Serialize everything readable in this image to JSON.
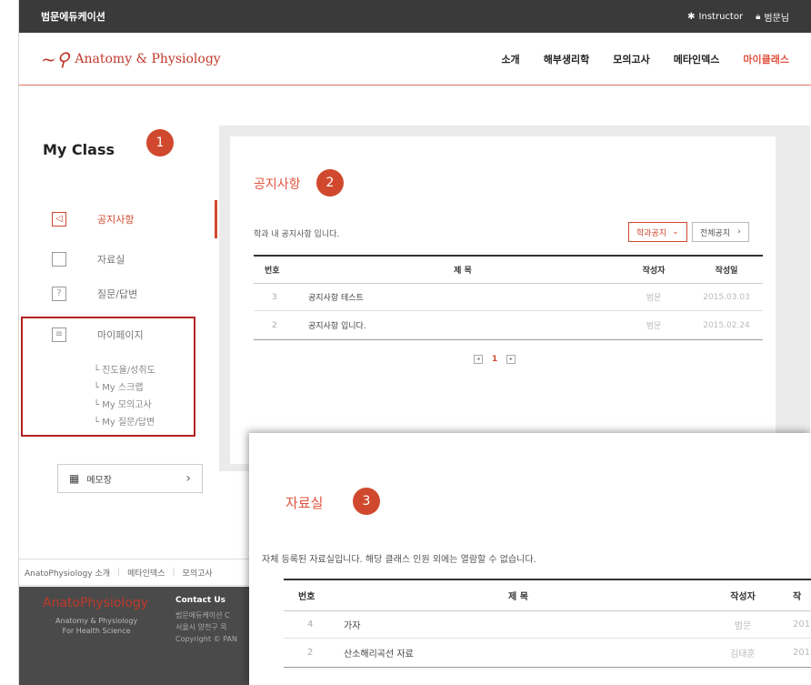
{
  "topbar": {
    "brand": "범문에듀케이션",
    "instructor": "Instructor",
    "user": "범문님"
  },
  "header": {
    "logo_text": "Anatomy & Physiology",
    "nav": [
      "소개",
      "해부생리학",
      "모의고사",
      "메타인덱스",
      "마이클래스"
    ]
  },
  "sidebar": {
    "title": "My Class",
    "items": [
      {
        "label": "공지사항",
        "icon": "megaphone-icon"
      },
      {
        "label": "자료실",
        "icon": "folder-icon"
      },
      {
        "label": "질문/답변",
        "icon": "question-icon"
      },
      {
        "label": "마이페이지",
        "icon": "document-icon"
      }
    ],
    "subitems": [
      "진도율/성취도",
      "My 스크랩",
      "My 모의고사",
      "My 질문/답변"
    ],
    "memo": "메모장"
  },
  "badges": [
    "1",
    "2",
    "3"
  ],
  "notice": {
    "title": "공지사항",
    "desc": "학과 내 공지사항 입니다.",
    "btn_category": "학과공지",
    "btn_all": "전체공지",
    "columns": [
      "번호",
      "제 목",
      "작성자",
      "작성일"
    ],
    "rows": [
      {
        "num": "3",
        "title": "공지사항 테스트",
        "author": "범문",
        "date": "2015.03.03"
      },
      {
        "num": "2",
        "title": "공지사항 입니다.",
        "author": "범문",
        "date": "2015.02.24"
      }
    ],
    "page": "1"
  },
  "archive": {
    "title": "자료실",
    "desc": "자체 등록된 자료실입니다. 해당 클래스 인원 외에는 열람할 수 없습니다.",
    "columns": [
      "번호",
      "제 목",
      "작성자",
      "작"
    ],
    "rows": [
      {
        "num": "4",
        "title": "가자",
        "author": "범문",
        "date": "201"
      },
      {
        "num": "2",
        "title": "산소해리곡선 자료",
        "author": "김태훈",
        "date": "201"
      }
    ]
  },
  "footer": {
    "links": [
      "AnatoPhysiology 소개",
      "메타인덱스",
      "모의고사"
    ],
    "brand": "AnatoPhysiology",
    "sub1": "Anatomy & Physiology",
    "sub2": "For Health Science",
    "contact": "Contact Us",
    "info1": "범문에듀케이션 C",
    "info2": "서울시 양천구 목",
    "info3": "Copyright © PAN"
  },
  "colors": {
    "accent": "#d0492e",
    "topbar": "#3a3a3a",
    "footer": "#4a4a4a"
  }
}
